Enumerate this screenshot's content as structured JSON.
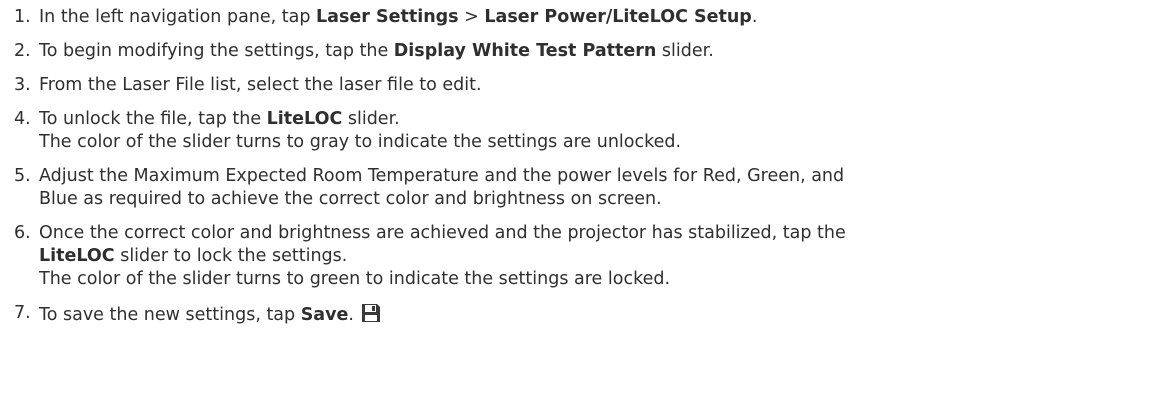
{
  "steps": [
    {
      "number": "1.",
      "parts": [
        {
          "text": "In the left navigation pane, tap "
        },
        {
          "text": "Laser Settings",
          "bold": true
        },
        {
          "text": " > "
        },
        {
          "text": "Laser Power/LiteLOC Setup",
          "bold": true
        },
        {
          "text": "."
        }
      ]
    },
    {
      "number": "2.",
      "parts": [
        {
          "text": "To begin modifying the settings, tap the "
        },
        {
          "text": "Display White Test Pattern",
          "bold": true
        },
        {
          "text": " slider."
        }
      ]
    },
    {
      "number": "3.",
      "parts": [
        {
          "text": "From the Laser File list, select the laser file to edit."
        }
      ]
    },
    {
      "number": "4.",
      "parts": [
        {
          "text": "To unlock the file, tap the "
        },
        {
          "text": "LiteLOC",
          "bold": true
        },
        {
          "text": " slider."
        }
      ],
      "note": "The color of the slider turns to gray to indicate the settings are unlocked."
    },
    {
      "number": "5.",
      "lines": [
        "Adjust the Maximum Expected Room Temperature and the power levels for Red, Green, and",
        "Blue as required to achieve the correct color and brightness on screen."
      ]
    },
    {
      "number": "6.",
      "parts_line1": [
        {
          "text": "Once the correct color and brightness are achieved and the projector has stabilized, tap the"
        }
      ],
      "parts_line2": [
        {
          "text": "LiteLOC",
          "bold": true
        },
        {
          "text": " slider to lock the settings."
        }
      ],
      "note": "The color of the slider turns to green to indicate the settings are locked."
    },
    {
      "number": "7.",
      "parts": [
        {
          "text": "To save the new settings, tap "
        },
        {
          "text": "Save",
          "bold": true
        },
        {
          "text": "."
        }
      ],
      "icon": "save-icon"
    }
  ]
}
